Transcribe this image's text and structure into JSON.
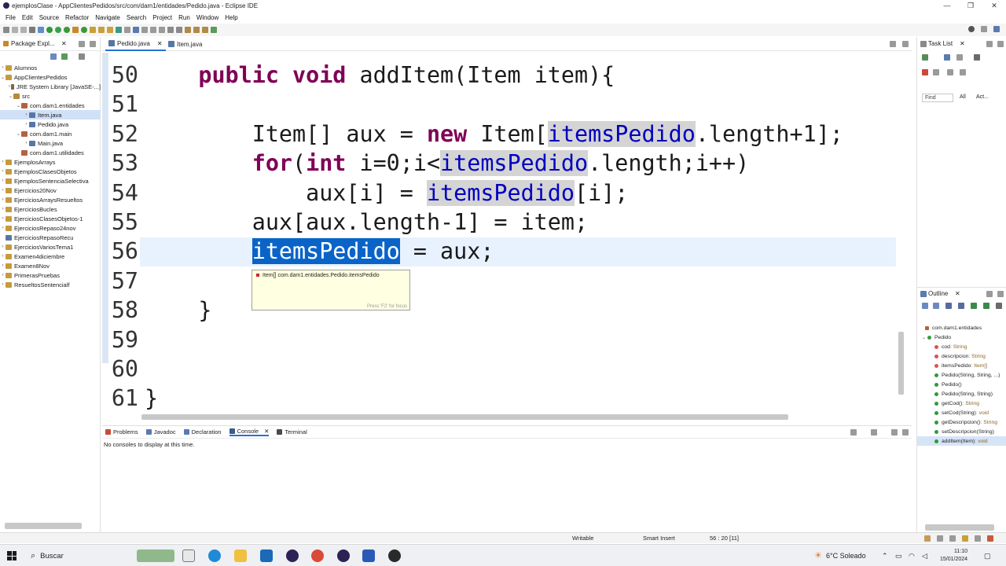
{
  "window": {
    "title": "ejemplosClase - AppClientesPedidos/src/com/dam1/entidades/Pedido.java - Eclipse IDE",
    "min_label": "—",
    "max_label": "❐",
    "close_label": "✕"
  },
  "menu": [
    "File",
    "Edit",
    "Source",
    "Refactor",
    "Navigate",
    "Search",
    "Project",
    "Run",
    "Window",
    "Help"
  ],
  "package_explorer": {
    "tab_label": "Package Expl...",
    "tree": [
      {
        "label": "Alumnos"
      },
      {
        "label": "AppClientesPedidos"
      },
      {
        "label": "JRE System Library [JavaSE-...]"
      },
      {
        "label": "src"
      },
      {
        "label": "com.dam1.entidades"
      },
      {
        "label": "Item.java"
      },
      {
        "label": "Pedido.java"
      },
      {
        "label": "com.dam1.main"
      },
      {
        "label": "Main.java"
      },
      {
        "label": "com.dam1.utilidades"
      },
      {
        "label": "EjemplosArrays"
      },
      {
        "label": "EjemplosClasesObjetos"
      },
      {
        "label": "EjemplosSentenciaSelectiva"
      },
      {
        "label": "Ejercicios20Nov"
      },
      {
        "label": "EjerciciosArraysResueltos"
      },
      {
        "label": "EjerciciosBucles"
      },
      {
        "label": "EjerciciosClasesObjetos-1"
      },
      {
        "label": "EjerciciosRepaso24nov"
      },
      {
        "label": "EjerciciosRepasoRecu"
      },
      {
        "label": "EjerciciosVariosTema1"
      },
      {
        "label": "Examen4diciembre"
      },
      {
        "label": "Examen8Nov"
      },
      {
        "label": "PrimerasPruebas"
      },
      {
        "label": "ResueltosSentencialf"
      }
    ]
  },
  "editor": {
    "tabs": [
      {
        "label": "Pedido.java"
      },
      {
        "label": "Item.java"
      }
    ],
    "lines": [
      {
        "n": "50",
        "tokens": [
          {
            "t": "    "
          },
          {
            "t": "public",
            "c": "kw"
          },
          {
            "t": " "
          },
          {
            "t": "void",
            "c": "kw"
          },
          {
            "t": " addItem(Item item){"
          }
        ]
      },
      {
        "n": "51",
        "tokens": []
      },
      {
        "n": "52",
        "tokens": [
          {
            "t": "        Item[] aux = "
          },
          {
            "t": "new",
            "c": "kw"
          },
          {
            "t": " Item["
          },
          {
            "t": "itemsPedido",
            "c": "fld occ"
          },
          {
            "t": ".length+1];"
          }
        ]
      },
      {
        "n": "53",
        "tokens": [
          {
            "t": "        "
          },
          {
            "t": "for",
            "c": "kw"
          },
          {
            "t": "("
          },
          {
            "t": "int",
            "c": "kw"
          },
          {
            "t": " i=0;i<"
          },
          {
            "t": "itemsPedido",
            "c": "fld occ"
          },
          {
            "t": ".length;i++)"
          }
        ]
      },
      {
        "n": "54",
        "tokens": [
          {
            "t": "            aux[i] = "
          },
          {
            "t": "itemsPedido",
            "c": "fld occ"
          },
          {
            "t": "[i];"
          }
        ]
      },
      {
        "n": "55",
        "tokens": [
          {
            "t": "        aux[aux.length-1] = item;"
          }
        ]
      },
      {
        "n": "56",
        "tokens": [
          {
            "t": "        "
          },
          {
            "t": "itemsPedido",
            "c": "selw"
          },
          {
            "t": " = aux;"
          }
        ]
      },
      {
        "n": "57",
        "tokens": []
      },
      {
        "n": "58",
        "tokens": [
          {
            "t": "    }"
          }
        ]
      },
      {
        "n": "59",
        "tokens": []
      },
      {
        "n": "60",
        "tokens": []
      },
      {
        "n": "61",
        "tokens": [
          {
            "t": "}"
          }
        ]
      }
    ],
    "tooltip": {
      "text": "Item[] com.dam1.entidades.Pedido.itemsPedido",
      "hint": "Press 'F2' for focus"
    }
  },
  "console": {
    "tabs": [
      "Problems",
      "Javadoc",
      "Declaration",
      "Console",
      "Terminal"
    ],
    "message": "No consoles to display at this time."
  },
  "task_list": {
    "tab_label": "Task List",
    "find_placeholder": "Find",
    "all_label": "All",
    "act_label": "Act..."
  },
  "outline": {
    "tab_label": "Outline",
    "items": [
      {
        "label": "com.dam1.entidades",
        "type": "",
        "kind": "pkg"
      },
      {
        "label": "Pedido",
        "type": "",
        "kind": "cls"
      },
      {
        "label": "cod",
        "type": " : String",
        "kind": "field"
      },
      {
        "label": "descripcion",
        "type": " : String",
        "kind": "field"
      },
      {
        "label": "itemsPedido",
        "type": " : Item[]",
        "kind": "field"
      },
      {
        "label": "Pedido(String, String, ...)",
        "type": "",
        "kind": "ctor"
      },
      {
        "label": "Pedido()",
        "type": "",
        "kind": "ctor"
      },
      {
        "label": "Pedido(String, String)",
        "type": "",
        "kind": "ctor"
      },
      {
        "label": "getCod()",
        "type": " : String",
        "kind": "method"
      },
      {
        "label": "setCod(String)",
        "type": " : void",
        "kind": "method"
      },
      {
        "label": "getDescripcion()",
        "type": " : String",
        "kind": "method"
      },
      {
        "label": "setDescripcion(String)",
        "type": "",
        "kind": "method"
      },
      {
        "label": "addItem(Item)",
        "type": " : void",
        "kind": "method"
      }
    ]
  },
  "status": {
    "writable": "Writable",
    "insert_mode": "Smart Insert",
    "position": "56 : 20 [11]"
  },
  "taskbar": {
    "search_label": "Buscar",
    "weather": "6°C Soleado",
    "time": "11:10",
    "date": "15/01/2024"
  }
}
